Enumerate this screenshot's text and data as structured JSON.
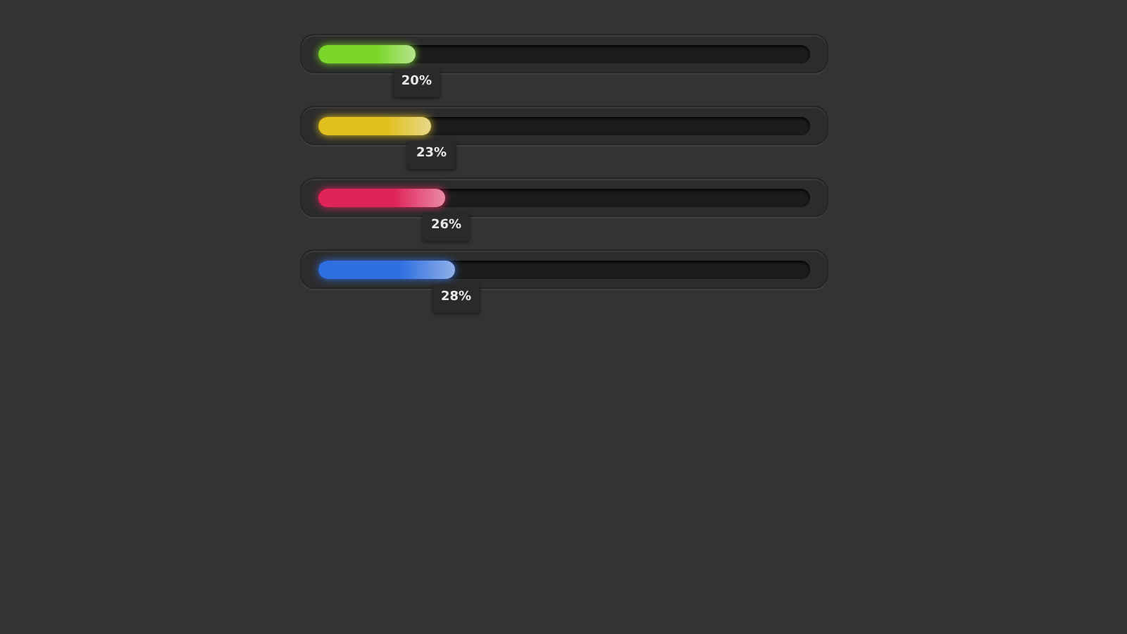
{
  "progress_bars": [
    {
      "level": 0.2,
      "color": "#7ad62a",
      "reading": "20%"
    },
    {
      "level": 0.23,
      "color": "#e0bf1e",
      "reading": "23%"
    },
    {
      "level": 0.26,
      "color": "#e0245a",
      "reading": "26%"
    },
    {
      "level": 0.28,
      "color": "#2f6fe0",
      "reading": "28%"
    }
  ]
}
